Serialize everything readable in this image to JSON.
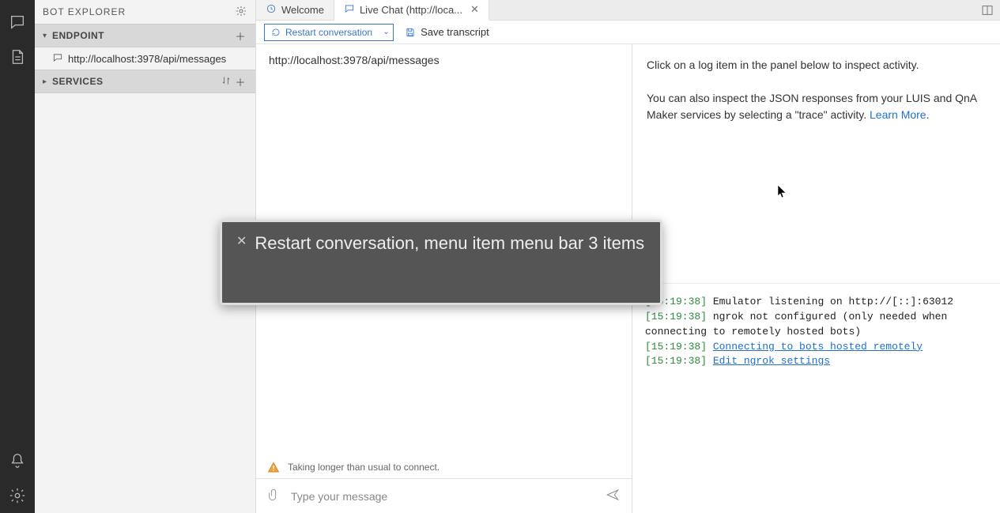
{
  "sidebar": {
    "title": "BOT EXPLORER",
    "sections": {
      "endpoint": {
        "label": "ENDPOINT",
        "item": "http://localhost:3978/api/messages"
      },
      "services": {
        "label": "SERVICES"
      }
    }
  },
  "tabs": [
    {
      "label": "Welcome",
      "icon": "home",
      "closable": false
    },
    {
      "label": "Live Chat (http://loca...",
      "icon": "chat",
      "closable": true
    }
  ],
  "toolbar": {
    "restart_label": "Restart conversation",
    "save_label": "Save transcript"
  },
  "chat": {
    "endpoint_url": "http://localhost:3978/api/messages",
    "warning": "Taking longer than usual to connect.",
    "input_placeholder": "Type your message"
  },
  "inspector": {
    "hint1": "Click on a log item in the panel below to inspect activity.",
    "hint2_a": "You can also inspect the JSON responses from your LUIS and QnA Maker services by selecting a \"trace\" activity. ",
    "learn_more": "Learn More"
  },
  "log": [
    {
      "ts": "15:19:38",
      "text": "Emulator listening on http://[::]:63012"
    },
    {
      "ts": "15:19:38",
      "text": "ngrok not configured (only needed when connecting to remotely hosted bots)"
    },
    {
      "ts": "15:19:38",
      "link": "Connecting to bots hosted remotely"
    },
    {
      "ts": "15:19:38",
      "link": "Edit ngrok settings"
    }
  ],
  "tooltip": {
    "text": "Restart conversation, menu item menu bar  3 items"
  }
}
